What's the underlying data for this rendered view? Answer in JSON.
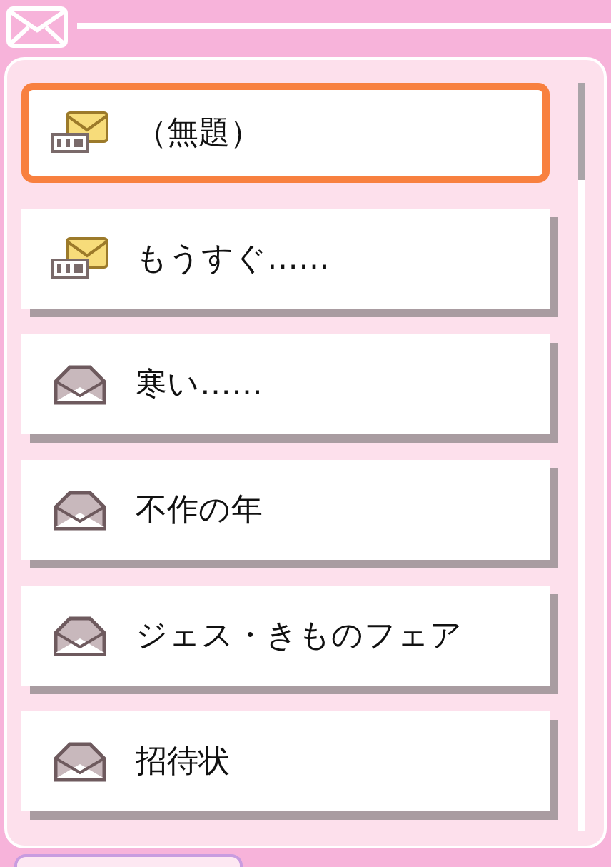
{
  "mails": [
    {
      "subject": "（無題）",
      "kind": "new",
      "selected": true
    },
    {
      "subject": "もうすぐ……",
      "kind": "new",
      "selected": false
    },
    {
      "subject": "寒い……",
      "kind": "opened",
      "selected": false
    },
    {
      "subject": "不作の年",
      "kind": "opened",
      "selected": false
    },
    {
      "subject": "ジェス・きものフェア",
      "kind": "opened",
      "selected": false
    },
    {
      "subject": "招待状",
      "kind": "opened",
      "selected": false
    }
  ]
}
